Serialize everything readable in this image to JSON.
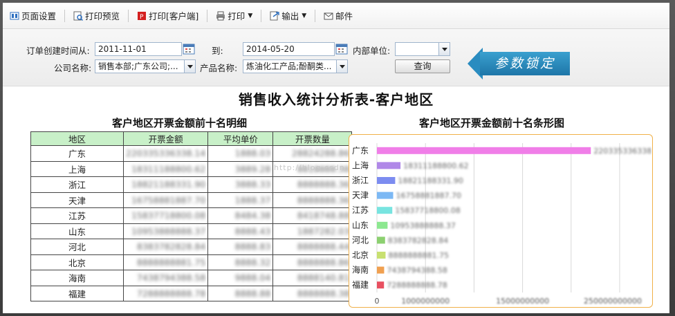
{
  "toolbar": {
    "page_setup": "页面设置",
    "print_preview": "打印预览",
    "print_client": "打印[客户端]",
    "print": "打印",
    "export": "输出",
    "mail": "邮件"
  },
  "params": {
    "order_time_from_label": "订单创建时间从:",
    "order_time_from": "2011-11-01",
    "to_label": "到:",
    "order_time_to": "2014-05-20",
    "internal_unit_label": "内部单位:",
    "internal_unit": "",
    "company_label": "公司名称:",
    "company": "销售本部;广东公司;...",
    "product_label": "产品名称:",
    "product": "炼油化工产品;酚酮类...",
    "query_button": "查询",
    "lock_label": "参数锁定"
  },
  "report": {
    "title": "销售收入统计分析表-客户地区",
    "table_title": "客户地区开票金额前十名明细",
    "chart_title": "客户地区开票金额前十名条形图",
    "watermark": "http://blog.csdn.",
    "columns": [
      "地区",
      "开票金额",
      "平均单价",
      "开票数量"
    ],
    "rows": [
      {
        "region": "广东",
        "amount": "220335336338.14",
        "avg_price": "1888.03",
        "quantity": "28824288.86"
      },
      {
        "region": "上海",
        "amount": "18311188800.62",
        "avg_price": "3889.28",
        "quantity": "8818888.38"
      },
      {
        "region": "浙江",
        "amount": "18821188331.90",
        "avg_price": "3888.33",
        "quantity": "8888888.36"
      },
      {
        "region": "天津",
        "amount": "16758881887.70",
        "avg_price": "1888.37",
        "quantity": "8888888.36"
      },
      {
        "region": "江苏",
        "amount": "15837718800.08",
        "avg_price": "8484.38",
        "quantity": "8418748.88"
      },
      {
        "region": "山东",
        "amount": "10953888888.37",
        "avg_price": "8888.43",
        "quantity": "1887282.03"
      },
      {
        "region": "河北",
        "amount": "8383782828.84",
        "avg_price": "8888.83",
        "quantity": "8888888.44"
      },
      {
        "region": "北京",
        "amount": "8888888881.75",
        "avg_price": "8888.32",
        "quantity": "8888888.86"
      },
      {
        "region": "海南",
        "amount": "7438794388.58",
        "avg_price": "9888.04",
        "quantity": "8888140.81"
      },
      {
        "region": "福建",
        "amount": "7288888888.78",
        "avg_price": "8888.88",
        "quantity": "8888888.38"
      }
    ]
  },
  "chart_data": {
    "type": "bar",
    "orientation": "horizontal",
    "title": "客户地区开票金额前十名条形图",
    "categories": [
      "广东",
      "上海",
      "浙江",
      "天津",
      "江苏",
      "山东",
      "河北",
      "北京",
      "海南",
      "福建"
    ],
    "values": [
      22033533633,
      2431118880,
      1882118833,
      1675888188,
      1583771880,
      1095388888,
      838378282,
      888888888,
      743879438,
      728888888
    ],
    "value_labels": [
      "220335336338.14",
      "18311188800.62",
      "18821188331.90",
      "16758881887.70",
      "15837718800.08",
      "10953888888.37",
      "8383782828.84",
      "8888888881.75",
      "7438794388.58",
      "7288888888.78"
    ],
    "colors": [
      "#f07ee8",
      "#b088e8",
      "#7c8cf0",
      "#7cb8f4",
      "#78e4e0",
      "#8ce890",
      "#8cd070",
      "#c8e070",
      "#f0a050",
      "#e85060"
    ],
    "xlim": [
      0,
      26000000000
    ],
    "x_ticks": [
      "0",
      "5000000000",
      "10000000000",
      "15000000000",
      "20000000000",
      "250000000000"
    ],
    "x_ticks_shown": [
      "0",
      "1000000000",
      "",
      "15000000000",
      "",
      "250000000000"
    ],
    "grid": true,
    "legend": "none"
  }
}
